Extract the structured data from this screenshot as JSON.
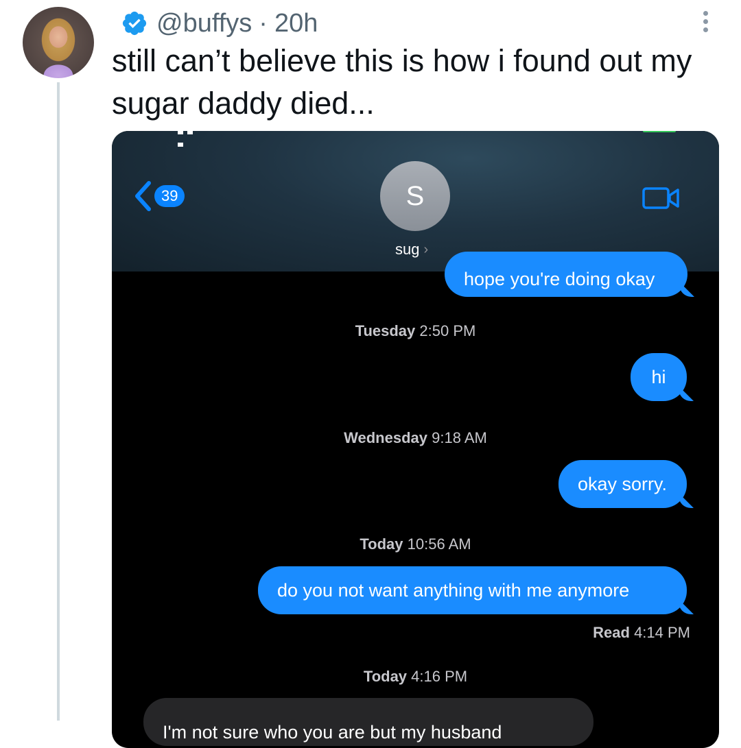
{
  "tweet": {
    "handle": "@buffys",
    "separator": "·",
    "time": "20h",
    "text": "still can’t believe this is how i found out my sugar daddy died..."
  },
  "screenshot": {
    "header": {
      "unread_count": "39",
      "contact_initial": "S",
      "contact_name": "sug",
      "chevron": "›"
    },
    "messages": [
      {
        "type": "sent",
        "text": "hope you're doing okay"
      },
      {
        "type": "timestamp",
        "day": "Tuesday",
        "time": "2:50 PM"
      },
      {
        "type": "sent",
        "text": "hi"
      },
      {
        "type": "timestamp",
        "day": "Wednesday",
        "time": "9:18 AM"
      },
      {
        "type": "sent",
        "text": "okay sorry."
      },
      {
        "type": "timestamp",
        "day": "Today",
        "time": "10:56 AM"
      },
      {
        "type": "sent",
        "text": "do you not want anything with me anymore"
      },
      {
        "type": "receipt",
        "label": "Read",
        "time": "4:14 PM"
      },
      {
        "type": "timestamp",
        "day": "Today",
        "time": "4:16 PM"
      },
      {
        "type": "received",
        "text": "I'm not sure who you are but my husband"
      }
    ]
  },
  "colors": {
    "bubble_sent": "#1a8cff",
    "bubble_received": "#262628",
    "badge": "#0a84ff",
    "verified": "#1d9bf0"
  },
  "icons": [
    "verified-badge-icon",
    "more-options-icon",
    "back-chevron-icon",
    "video-camera-icon"
  ]
}
